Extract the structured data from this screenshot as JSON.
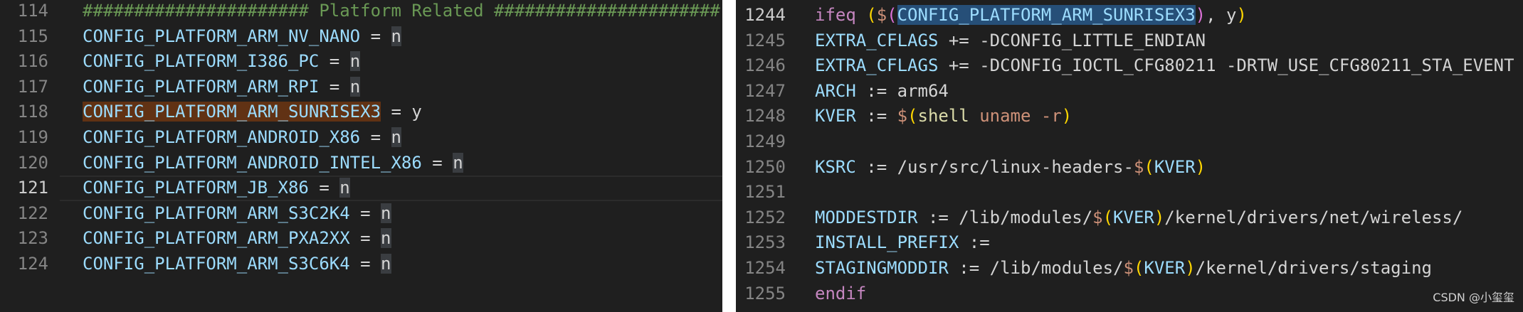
{
  "left_editor": {
    "lines": [
      {
        "num": "114",
        "parts": [
          {
            "t": "###################### Platform Related ######################",
            "c": "comment"
          }
        ]
      },
      {
        "num": "115",
        "parts": [
          {
            "t": "CONFIG_PLATFORM_ARM_NV_NANO",
            "c": "k"
          },
          {
            "t": " = ",
            "c": "pun"
          },
          {
            "t": "n",
            "c": "pun cursorbox"
          }
        ]
      },
      {
        "num": "116",
        "parts": [
          {
            "t": "CONFIG_PLATFORM_I386_PC",
            "c": "k"
          },
          {
            "t": " = ",
            "c": "pun"
          },
          {
            "t": "n",
            "c": "pun cursorbox"
          }
        ]
      },
      {
        "num": "117",
        "parts": [
          {
            "t": "CONFIG_PLATFORM_ARM_RPI",
            "c": "k"
          },
          {
            "t": " = ",
            "c": "pun"
          },
          {
            "t": "n",
            "c": "pun cursorbox"
          }
        ]
      },
      {
        "num": "118",
        "parts": [
          {
            "t": "CONFIG_PLATFORM_ARM_SUNRISEX3",
            "c": "k sel-orange"
          },
          {
            "t": " = y",
            "c": "pun"
          }
        ]
      },
      {
        "num": "119",
        "parts": [
          {
            "t": "CONFIG_PLATFORM_ANDROID_X86",
            "c": "k"
          },
          {
            "t": " = ",
            "c": "pun"
          },
          {
            "t": "n",
            "c": "pun cursorbox"
          }
        ]
      },
      {
        "num": "120",
        "parts": [
          {
            "t": "CONFIG_PLATFORM_ANDROID_INTEL_X86",
            "c": "k"
          },
          {
            "t": " = ",
            "c": "pun"
          },
          {
            "t": "n",
            "c": "pun cursorbox"
          }
        ]
      },
      {
        "num": "121",
        "current": true,
        "parts": [
          {
            "t": "CONFIG_PLATFORM_JB_X86",
            "c": "k"
          },
          {
            "t": " = ",
            "c": "pun"
          },
          {
            "t": "n",
            "c": "pun cursorbox"
          }
        ]
      },
      {
        "num": "122",
        "parts": [
          {
            "t": "CONFIG_PLATFORM_ARM_S3C2K4",
            "c": "k"
          },
          {
            "t": " = ",
            "c": "pun"
          },
          {
            "t": "n",
            "c": "pun cursorbox"
          }
        ]
      },
      {
        "num": "123",
        "parts": [
          {
            "t": "CONFIG_PLATFORM_ARM_PXA2XX",
            "c": "k"
          },
          {
            "t": " = ",
            "c": "pun"
          },
          {
            "t": "n",
            "c": "pun cursorbox"
          }
        ]
      },
      {
        "num": "124",
        "parts": [
          {
            "t": "CONFIG_PLATFORM_ARM_S3C6K4",
            "c": "k"
          },
          {
            "t": " = ",
            "c": "pun"
          },
          {
            "t": "n",
            "c": "pun cursorbox"
          }
        ]
      }
    ]
  },
  "right_editor": {
    "lines": [
      {
        "num": "1244",
        "active": true,
        "parts": [
          {
            "t": "ifeq",
            "c": "kw"
          },
          {
            "t": " ",
            "c": "pun"
          },
          {
            "t": "(",
            "c": "br1"
          },
          {
            "t": "$",
            "c": "str"
          },
          {
            "t": "(",
            "c": "br2"
          },
          {
            "t": "CONFIG_PLATFORM_ARM_SUNRISEX3",
            "c": "k sel-blue"
          },
          {
            "t": ")",
            "c": "br2"
          },
          {
            "t": ", y",
            "c": "pun"
          },
          {
            "t": ")",
            "c": "br1"
          }
        ]
      },
      {
        "num": "1245",
        "parts": [
          {
            "t": "EXTRA_CFLAGS",
            "c": "k"
          },
          {
            "t": " += -DCONFIG_LITTLE_ENDIAN",
            "c": "pun"
          }
        ]
      },
      {
        "num": "1246",
        "parts": [
          {
            "t": "EXTRA_CFLAGS",
            "c": "k"
          },
          {
            "t": " += -DCONFIG_IOCTL_CFG80211 -DRTW_USE_CFG80211_STA_EVENT",
            "c": "pun"
          }
        ]
      },
      {
        "num": "1247",
        "parts": [
          {
            "t": "ARCH",
            "c": "k"
          },
          {
            "t": " := arm64",
            "c": "pun"
          }
        ]
      },
      {
        "num": "1248",
        "parts": [
          {
            "t": "KVER",
            "c": "k"
          },
          {
            "t": " := ",
            "c": "pun"
          },
          {
            "t": "$",
            "c": "str"
          },
          {
            "t": "(",
            "c": "br1"
          },
          {
            "t": "shell",
            "c": "fn"
          },
          {
            "t": " uname -r",
            "c": "str"
          },
          {
            "t": ")",
            "c": "br1"
          }
        ]
      },
      {
        "num": "1249",
        "parts": []
      },
      {
        "num": "1250",
        "parts": [
          {
            "t": "KSRC",
            "c": "k"
          },
          {
            "t": " := /usr/src/linux-headers-",
            "c": "pun"
          },
          {
            "t": "$",
            "c": "str"
          },
          {
            "t": "(",
            "c": "br1"
          },
          {
            "t": "KVER",
            "c": "k"
          },
          {
            "t": ")",
            "c": "br1"
          }
        ]
      },
      {
        "num": "1251",
        "parts": []
      },
      {
        "num": "1252",
        "parts": [
          {
            "t": "MODDESTDIR",
            "c": "k"
          },
          {
            "t": " := /lib/modules/",
            "c": "pun"
          },
          {
            "t": "$",
            "c": "str"
          },
          {
            "t": "(",
            "c": "br1"
          },
          {
            "t": "KVER",
            "c": "k"
          },
          {
            "t": ")",
            "c": "br1"
          },
          {
            "t": "/kernel/drivers/net/wireless/",
            "c": "pun"
          }
        ]
      },
      {
        "num": "1253",
        "parts": [
          {
            "t": "INSTALL_PREFIX",
            "c": "k"
          },
          {
            "t": " :=",
            "c": "pun"
          }
        ]
      },
      {
        "num": "1254",
        "parts": [
          {
            "t": "STAGINGMODDIR",
            "c": "k"
          },
          {
            "t": " := /lib/modules/",
            "c": "pun"
          },
          {
            "t": "$",
            "c": "str"
          },
          {
            "t": "(",
            "c": "br1"
          },
          {
            "t": "KVER",
            "c": "k"
          },
          {
            "t": ")",
            "c": "br1"
          },
          {
            "t": "/kernel/drivers/staging",
            "c": "pun"
          }
        ]
      },
      {
        "num": "1255",
        "parts": [
          {
            "t": "endif",
            "c": "kw"
          }
        ]
      }
    ]
  },
  "watermark": "CSDN @小玺玺",
  "colors": {
    "editor_bg": "#1f1f1f",
    "variable": "#9cdcfe",
    "comment": "#6a9955",
    "keyword": "#c586c0",
    "function": "#dcdcaa",
    "string": "#ce9178",
    "selection_orange": "#613214",
    "selection_blue": "#264f78"
  }
}
